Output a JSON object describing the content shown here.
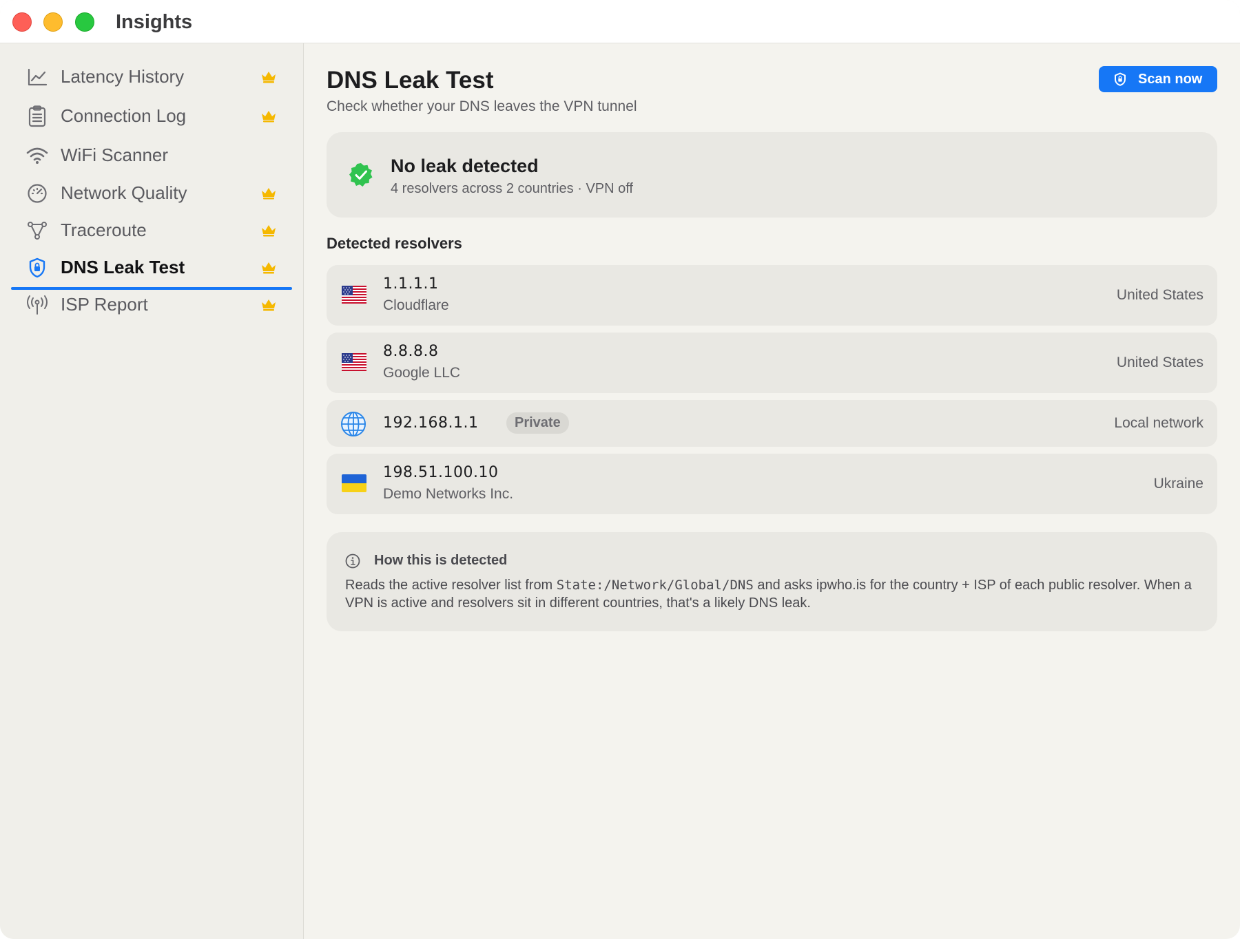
{
  "window": {
    "title": "Insights"
  },
  "sidebar": {
    "items": [
      {
        "label": "Latency History",
        "icon": "chart-line-icon",
        "premium": true,
        "active": false
      },
      {
        "label": "Connection Log",
        "icon": "clipboard-icon",
        "premium": true,
        "active": false
      },
      {
        "label": "WiFi Scanner",
        "icon": "wifi-icon",
        "premium": false,
        "active": false
      },
      {
        "label": "Network Quality",
        "icon": "gauge-icon",
        "premium": true,
        "active": false
      },
      {
        "label": "Traceroute",
        "icon": "network-nodes-icon",
        "premium": true,
        "active": false
      },
      {
        "label": "DNS Leak Test",
        "icon": "shield-lock-icon",
        "premium": true,
        "active": true
      },
      {
        "label": "ISP Report",
        "icon": "antenna-icon",
        "premium": true,
        "active": false
      }
    ]
  },
  "main": {
    "title": "DNS Leak Test",
    "subtitle": "Check whether your DNS leaves the VPN tunnel",
    "scan_button": "Scan now",
    "status": {
      "title": "No leak detected",
      "subtitle": "4 resolvers across 2 countries · VPN off",
      "color": "#30c34f"
    },
    "resolvers_title": "Detected resolvers",
    "resolvers": [
      {
        "ip": "1.1.1.1",
        "isp": "Cloudflare",
        "country": "United States",
        "flag": "us-flag-icon"
      },
      {
        "ip": "8.8.8.8",
        "isp": "Google LLC",
        "country": "United States",
        "flag": "us-flag-icon"
      },
      {
        "ip": "192.168.1.1",
        "tag": "Private",
        "country": "Local network",
        "flag": "globe-icon"
      },
      {
        "ip": "198.51.100.10",
        "isp": "Demo Networks Inc.",
        "country": "Ukraine",
        "flag": "ua-flag-icon"
      }
    ],
    "info": {
      "title": "How this is detected",
      "body_before": "Reads the active resolver list from ",
      "body_code": "State:/Network/Global/DNS",
      "body_after": " and asks ipwho.is for the country + ISP of each public resolver. When a VPN is active and resolvers sit in different countries, that's a likely DNS leak."
    }
  },
  "colors": {
    "accent": "#1677f6",
    "crown": "#f5b800",
    "success": "#30c34f"
  }
}
